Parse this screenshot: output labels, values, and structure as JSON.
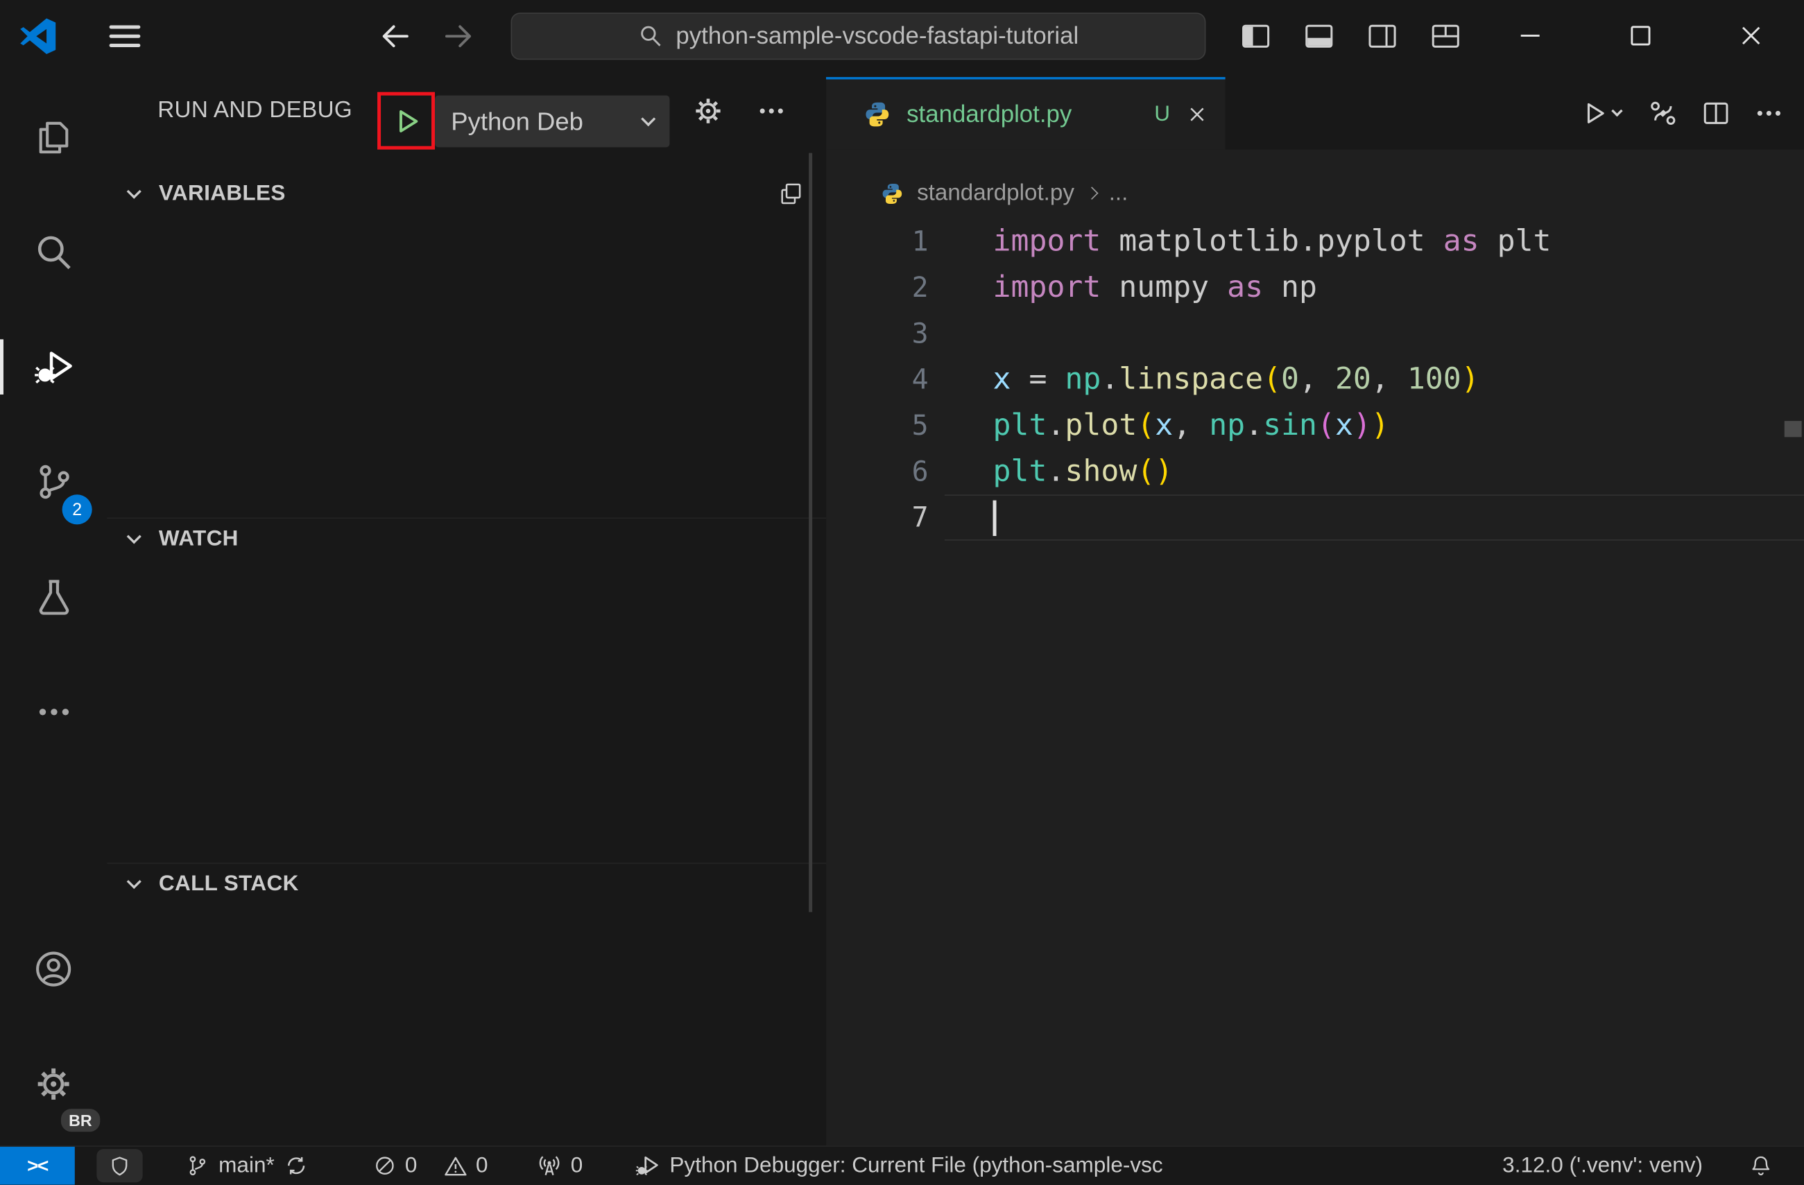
{
  "theme": {
    "accent": "#0078D4",
    "badge": "#0078D4",
    "remote": "#0078D4",
    "untracked": "#73C991",
    "debug-start": "#89D185",
    "annotation": "#F0141E"
  },
  "titlebar": {
    "search_value": "python-sample-vscode-fastapi-tutorial"
  },
  "activity_bar": {
    "scm_badge": "2",
    "profile_badge": "BR"
  },
  "run_panel": {
    "title": "RUN AND DEBUG",
    "config_label": "Python Deb",
    "sections": {
      "variables": "VARIABLES",
      "watch": "WATCH",
      "call_stack": "CALL STACK"
    }
  },
  "editor": {
    "tab_filename": "standardplot.py",
    "tab_modifier": "U",
    "breadcrumb_file": "standardplot.py",
    "breadcrumb_more": "...",
    "colors": {
      "keyword": "#C586C0",
      "plain": "#CCCCCC",
      "type": "#4EC9B0",
      "function": "#DCDCAA",
      "number": "#B5CEA8",
      "variable": "#9CDCFE",
      "bracket1": "#FFD700",
      "bracket2": "#DA70D6"
    },
    "lines": [
      {
        "num": "1",
        "tokens": [
          [
            "import",
            "keyword"
          ],
          [
            " matplotlib.pyplot ",
            "plain"
          ],
          [
            "as",
            "keyword"
          ],
          [
            " plt",
            "plain"
          ]
        ]
      },
      {
        "num": "2",
        "tokens": [
          [
            "import",
            "keyword"
          ],
          [
            " numpy ",
            "plain"
          ],
          [
            "as",
            "keyword"
          ],
          [
            " np",
            "plain"
          ]
        ]
      },
      {
        "num": "3",
        "tokens": []
      },
      {
        "num": "4",
        "tokens": [
          [
            "x",
            "variable"
          ],
          [
            " = ",
            "plain"
          ],
          [
            "np",
            "type"
          ],
          [
            ".",
            "plain"
          ],
          [
            "linspace",
            "function"
          ],
          [
            "(",
            "bracket1"
          ],
          [
            "0",
            "number"
          ],
          [
            ", ",
            "plain"
          ],
          [
            "20",
            "number"
          ],
          [
            ", ",
            "plain"
          ],
          [
            "100",
            "number"
          ],
          [
            ")",
            "bracket1"
          ]
        ]
      },
      {
        "num": "5",
        "tokens": [
          [
            "plt",
            "type"
          ],
          [
            ".",
            "plain"
          ],
          [
            "plot",
            "function"
          ],
          [
            "(",
            "bracket1"
          ],
          [
            "x",
            "variable"
          ],
          [
            ", ",
            "plain"
          ],
          [
            "np",
            "type"
          ],
          [
            ".",
            "plain"
          ],
          [
            "sin",
            "type"
          ],
          [
            "(",
            "bracket2"
          ],
          [
            "x",
            "variable"
          ],
          [
            ")",
            "bracket2"
          ],
          [
            ")",
            "bracket1"
          ]
        ]
      },
      {
        "num": "6",
        "tokens": [
          [
            "plt",
            "type"
          ],
          [
            ".",
            "plain"
          ],
          [
            "show",
            "function"
          ],
          [
            "(",
            "bracket1"
          ],
          [
            ")",
            "bracket1"
          ]
        ]
      },
      {
        "num": "7",
        "tokens": [],
        "cursor": true,
        "current": true
      }
    ]
  },
  "status_bar": {
    "remote_glyph": "><",
    "branch": "main*",
    "errors": "0",
    "warnings": "0",
    "ports": "0",
    "debug_status": "Python Debugger: Current File (python-sample-vsc",
    "python_version": "3.12.0 ('.venv': venv)"
  }
}
